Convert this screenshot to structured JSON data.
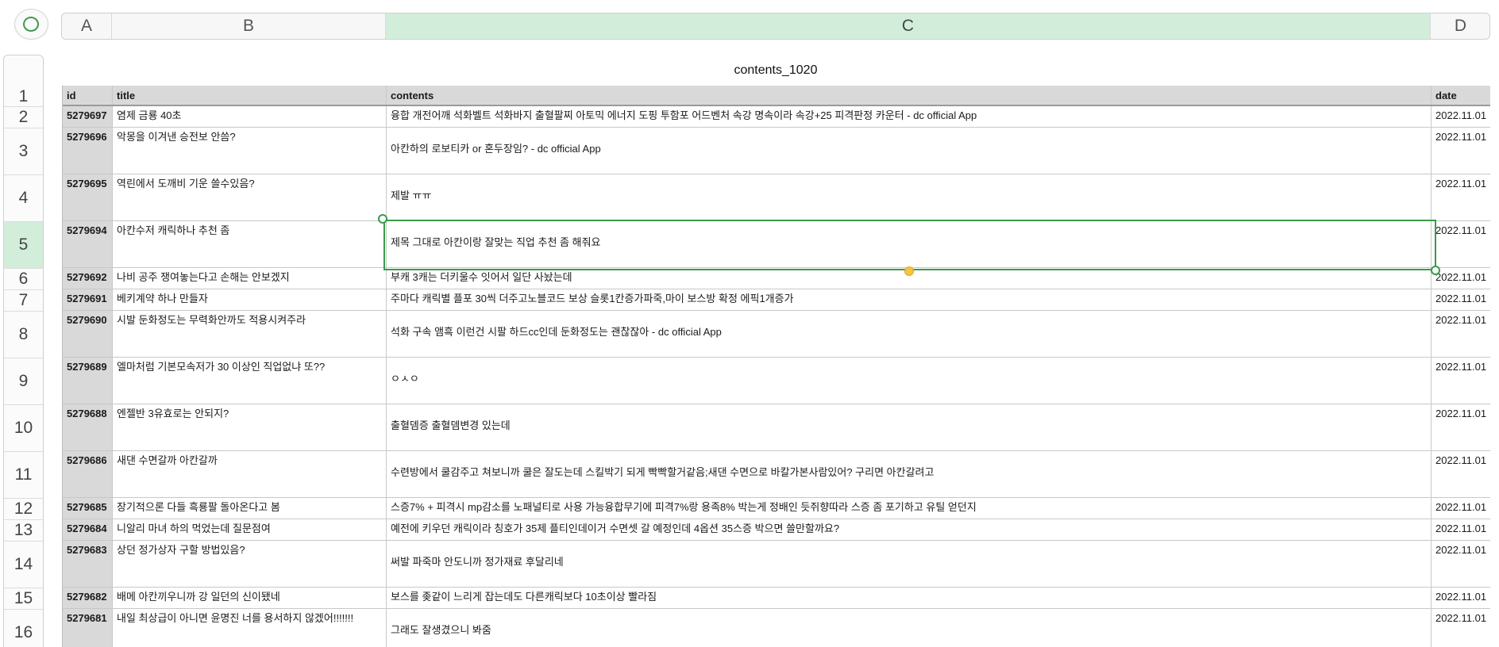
{
  "columns": [
    {
      "letter": "A",
      "width": 63
    },
    {
      "letter": "B",
      "width": 345
    },
    {
      "letter": "C",
      "width": 1316,
      "selected": true
    },
    {
      "letter": "D",
      "width": 76
    }
  ],
  "table": {
    "title": "contents_1020",
    "headers": [
      "id",
      "title",
      "contents",
      "date"
    ],
    "rows": [
      {
        "num": "2",
        "id": "5279697",
        "title": "염제 금룡 40초",
        "contents": "융합 개전어깨 석화벨트 석화바지 출혈팔찌 아토믹 에너지 도핑 투함포 어드벤처 속강 명속이라 속강+25 피격판정 카운터  - dc official App",
        "date": "2022.11.01"
      },
      {
        "num": "3",
        "id": "5279696",
        "title": "악몽을 이겨낸 승전보 안씀?",
        "contents": "아칸하의 로보티카 or 혼두장임?  - dc official App",
        "date": "2022.11.01"
      },
      {
        "num": "4",
        "id": "5279695",
        "title": "역린에서 도깨비 기운 쓸수있음?",
        "contents": "제발 ㅠㅠ",
        "date": "2022.11.01"
      },
      {
        "num": "5",
        "id": "5279694",
        "title": "아칸수저 캐릭하나 추천 좀",
        "contents": "제목 그대로 아칸이랑 잘맞는 직업 추천 좀 해줘요",
        "date": "2022.11.01",
        "selected": true
      },
      {
        "num": "6",
        "id": "5279692",
        "title": "나비 공주 쟁여놓는다고 손해는 안보겠지",
        "contents": "부캐 3캐는 더키울수 잇어서 일단 사놨는데",
        "date": "2022.11.01"
      },
      {
        "num": "7",
        "id": "5279691",
        "title": "베키계약 하나 만들자",
        "contents": "주마다 캐릭별 플포 30씩 더주고노블코드 보상 슬롯1칸증가파죽,마이 보스방 확정 에픽1개증가",
        "date": "2022.11.01"
      },
      {
        "num": "8",
        "id": "5279690",
        "title": "시발 둔화정도는 무력화안까도 적용시켜주라",
        "contents": "석화 구속 앰흑 이런건 시팔 하드cc인데 둔화정도는 괜찮잖아  - dc official App",
        "date": "2022.11.01"
      },
      {
        "num": "9",
        "id": "5279689",
        "title": "엘마처럼 기본모속저가 30 이상인 직업없냐 또??",
        "contents": "ㅇㅅㅇ",
        "date": "2022.11.01"
      },
      {
        "num": "10",
        "id": "5279688",
        "title": "엔젤반 3유효로는 안되지?",
        "contents": "출혈뎀증 출혈뎀변경 있는데",
        "date": "2022.11.01"
      },
      {
        "num": "11",
        "id": "5279686",
        "title": "새댄 수면갈까 아칸갈까",
        "contents": "수련방에서 쿨감주고 쳐보니까 쿨은 잘도는데 스킬박기 되게 빡빡할거같음;새댄 수면으로 바칼가본사람있어? 구리면 아칸갈려고",
        "date": "2022.11.01"
      },
      {
        "num": "12",
        "id": "5279685",
        "title": "장기적으론 다들 흑룡팔 돌아온다고 봄",
        "contents": "스증7% + 피격시 mp감소를 노패널티로 사용 가능융합무기에 피격7%랑 용족8% 박는게 정배인 듯쥐향따라 스증 좀 포기하고 유틸 얻던지",
        "date": "2022.11.01"
      },
      {
        "num": "13",
        "id": "5279684",
        "title": "니알리 마녀 하의 먹었는데 질문점여",
        "contents": "예전에 키우던 캐릭이라 칭호가 35제 플티인데이거 수면셋 갈 예정인데 4옵션 35스증 박으면 쓸만할까요?",
        "date": "2022.11.01"
      },
      {
        "num": "14",
        "id": "5279683",
        "title": "상던 정가상자 구할 방법있음?",
        "contents": "써발 파죽마 안도니까 정가재료 후달리네",
        "date": "2022.11.01"
      },
      {
        "num": "15",
        "id": "5279682",
        "title": "배메 아칸끼우니까 강 일던의 신이됐네",
        "contents": "보스를 좆같이 느리게 잡는데도 다른캐릭보다 10초이상 빨라짐",
        "date": "2022.11.01"
      },
      {
        "num": "16",
        "id": "5279681",
        "title": "내일 최상급이 아니면 윤명진 너를 용서하지 않겠어!!!!!!!",
        "contents": "그래도 잘생겼으니 봐줌",
        "date": "2022.11.01"
      }
    ]
  }
}
